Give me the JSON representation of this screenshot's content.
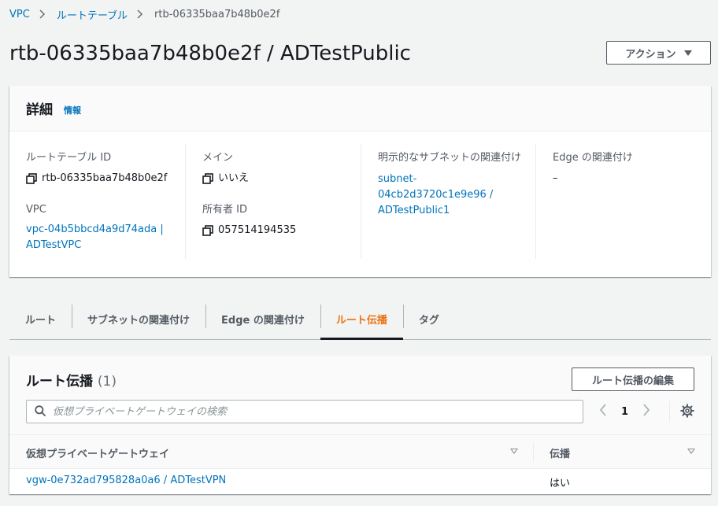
{
  "breadcrumb": [
    {
      "label": "VPC"
    },
    {
      "label": "ルートテーブル"
    },
    {
      "label": "rtb-06335baa7b48b0e2f"
    }
  ],
  "page": {
    "title": "rtb-06335baa7b48b0e2f / ADTestPublic",
    "action_label": "アクション"
  },
  "details": {
    "title": "詳細",
    "info_label": "情報",
    "route_table_id": {
      "label": "ルートテーブル ID",
      "value": "rtb-06335baa7b48b0e2f"
    },
    "vpc": {
      "label": "VPC",
      "value": "vpc-04b5bbcd4a9d74ada | ADTestVPC"
    },
    "main": {
      "label": "メイン",
      "value": "いいえ"
    },
    "owner_id": {
      "label": "所有者 ID",
      "value": "057514194535"
    },
    "explicit_subnet": {
      "label": "明示的なサブネットの関連付け",
      "value": "subnet-04cb2d3720c1e9e96 / ADTestPublic1"
    },
    "edge_association": {
      "label": "Edge の関連付け",
      "value": "–"
    }
  },
  "tabs": [
    {
      "label": "ルート"
    },
    {
      "label": "サブネットの関連付け"
    },
    {
      "label": "Edge の関連付け"
    },
    {
      "label": "ルート伝播",
      "active": true
    },
    {
      "label": "タグ"
    }
  ],
  "propagation": {
    "title": "ルート伝播",
    "count": "(1)",
    "edit_label": "ルート伝播の編集",
    "search_placeholder": "仮想プライベートゲートウェイの検索",
    "page_number": "1",
    "columns": [
      "仮想プライベートゲートウェイ",
      "伝播"
    ],
    "rows": [
      {
        "gateway": "vgw-0e732ad795828a0a6 / ADTestVPN",
        "propagation": "はい"
      }
    ]
  },
  "colors": {
    "link": "#0073bb",
    "active_tab": "#ec7211",
    "text": "#16191f",
    "secondary": "#545b64"
  }
}
